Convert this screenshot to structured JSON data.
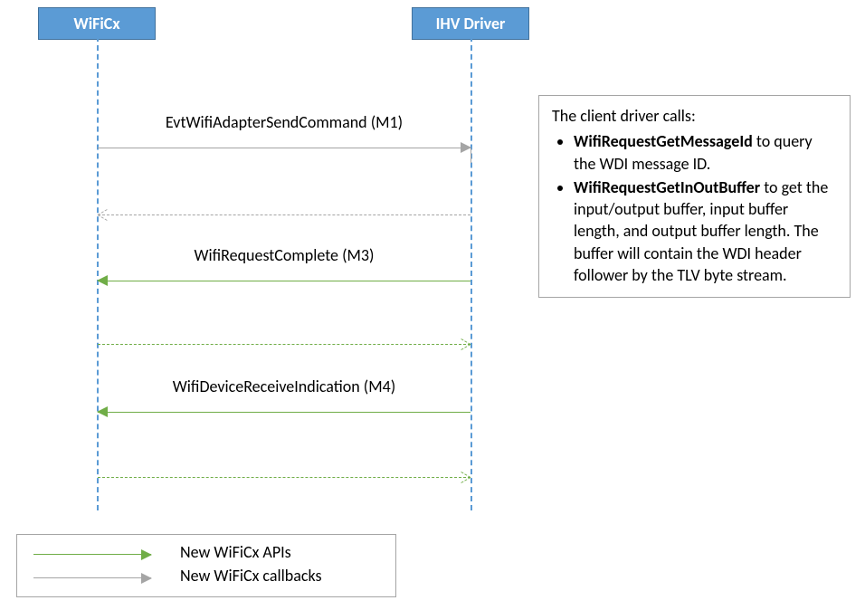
{
  "participants": {
    "left": "WiFiCx",
    "right": "IHV Driver"
  },
  "messages": {
    "m1": "EvtWifiAdapterSendCommand (M1)",
    "m3": "WifiRequestComplete (M3)",
    "m4": "WifiDeviceReceiveIndication (M4)"
  },
  "note": {
    "intro": "The client driver calls:",
    "bullets": [
      {
        "api": "WifiRequestGetMessageId",
        "rest": " to query the WDI message ID."
      },
      {
        "api": "WifiRequestGetInOutBuffer",
        "rest": " to get the input/output buffer, input buffer length, and output buffer length. The buffer will contain the WDI header follower by the TLV byte stream."
      }
    ]
  },
  "legend": {
    "apis": "New WiFiCx APIs",
    "callbacks": "New WiFiCx callbacks"
  }
}
